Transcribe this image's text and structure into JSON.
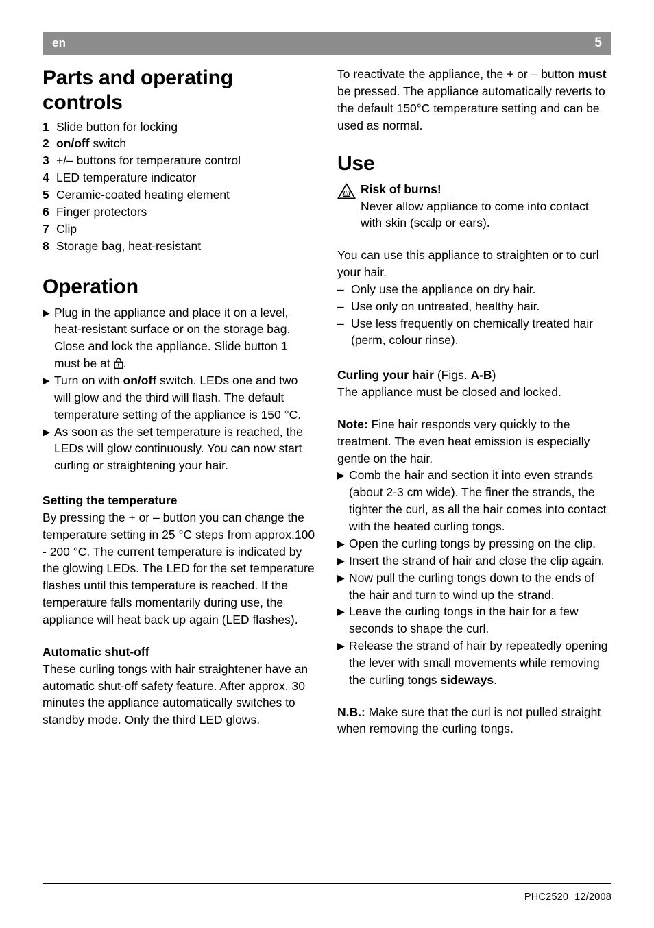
{
  "header": {
    "language": "en",
    "page_number": "5",
    "bar_color": "#8d8d8d",
    "text_color": "#ffffff"
  },
  "left_column": {
    "parts_heading": "Parts and operating controls",
    "parts_list": [
      {
        "num": "1",
        "text": "Slide button for locking",
        "bold_prefix": ""
      },
      {
        "num": "2",
        "text": " switch",
        "bold_prefix": "on/off"
      },
      {
        "num": "3",
        "text": "+/– buttons for temperature control",
        "bold_prefix": ""
      },
      {
        "num": "4",
        "text": "LED temperature indicator",
        "bold_prefix": ""
      },
      {
        "num": "5",
        "text": "Ceramic-coated heating element",
        "bold_prefix": ""
      },
      {
        "num": "6",
        "text": "Finger protectors",
        "bold_prefix": ""
      },
      {
        "num": "7",
        "text": "Clip",
        "bold_prefix": ""
      },
      {
        "num": "8",
        "text": "Storage bag, heat-resistant",
        "bold_prefix": ""
      }
    ],
    "operation_heading": "Operation",
    "operation_bullets": {
      "b1_part1": "Plug in the appliance and place it on a level, heat-resistant surface or on the storage bag. Close and lock the appliance. Slide button ",
      "b1_bold": "1",
      "b1_part2": " must be at ",
      "b1_icon": "lock-icon",
      "b1_part3": ".",
      "b2_part1": "Turn on with ",
      "b2_bold": "on/off",
      "b2_part2": " switch. LEDs one and two will glow and the third will flash. The default temperature setting of the appliance is 150 °C.",
      "b3": "As soon as the set temperature is reached, the LEDs will glow continuously. You can now start curling or straightening your hair."
    },
    "setting_temp_heading": "Setting the temperature",
    "setting_temp_body": "By pressing the + or – button you can change the temperature setting in 25 °C steps from approx.100 - 200 °C. The current temperature is indicated by the glowing LEDs. The LED for the set temperature flashes until this temperature is reached. If the temperature falls momentarily during use, the appliance will heat back up again (LED flashes).",
    "auto_shutoff_heading": "Automatic shut-off",
    "auto_shutoff_body": "These curling tongs with hair straightener have an automatic shut-off safety feature. After approx. 30 minutes the appliance automatically switches to standby mode. Only the third LED glows."
  },
  "right_column": {
    "reactivate_part1": "To reactivate the appliance, the + or – button ",
    "reactivate_bold": "must",
    "reactivate_part2": " be pressed. The appliance automatically reverts to the default 150°C temperature setting and can be used as normal.",
    "use_heading": "Use",
    "warning": {
      "icon": "warning-triangle-hot-surface-icon",
      "title": "Risk of burns!",
      "body": "Never allow appliance to come into contact with skin (scalp or ears)."
    },
    "use_intro": "You can use this appliance to straighten or to curl your hair.",
    "use_dash_list": [
      "Only use the appliance on dry hair.",
      "Use only on untreated, healthy hair.",
      "Use less frequently on chemically treated hair (perm, colour rinse)."
    ],
    "curling_heading_bold": "Curling your hair",
    "curling_heading_rest1": " (Figs. ",
    "curling_heading_figs": "A-B",
    "curling_heading_rest2": ")",
    "curling_subline": "The appliance must be closed and locked.",
    "note_bold": "Note:",
    "note_body": " Fine hair responds very quickly to the treatment. The even heat emission is especially gentle on the hair.",
    "curling_bullets": [
      "Comb the hair and section it into even strands (about 2-3 cm wide). The finer the strands, the tighter the curl, as all the hair comes into contact with the heated curling tongs.",
      "Open the curling tongs by pressing on the clip.",
      "Insert the strand of hair and close the clip again.",
      "Now pull the curling tongs down to the ends of the hair and turn to wind up the strand.",
      "Leave the curling tongs in the hair for a few seconds to shape the curl."
    ],
    "release_bullet_part1": "Release the strand of hair by repeatedly opening the lever with small movements while removing the curling tongs ",
    "release_bullet_bold": "sideways",
    "release_bullet_part2": ".",
    "nb_bold": "N.B.:",
    "nb_body": " Make sure that the curl is not pulled straight when removing the curling tongs."
  },
  "footer": {
    "model": "PHC2520",
    "date": "12/2008"
  },
  "icons": {
    "bullet_triangle": "▶",
    "dash": "–"
  }
}
